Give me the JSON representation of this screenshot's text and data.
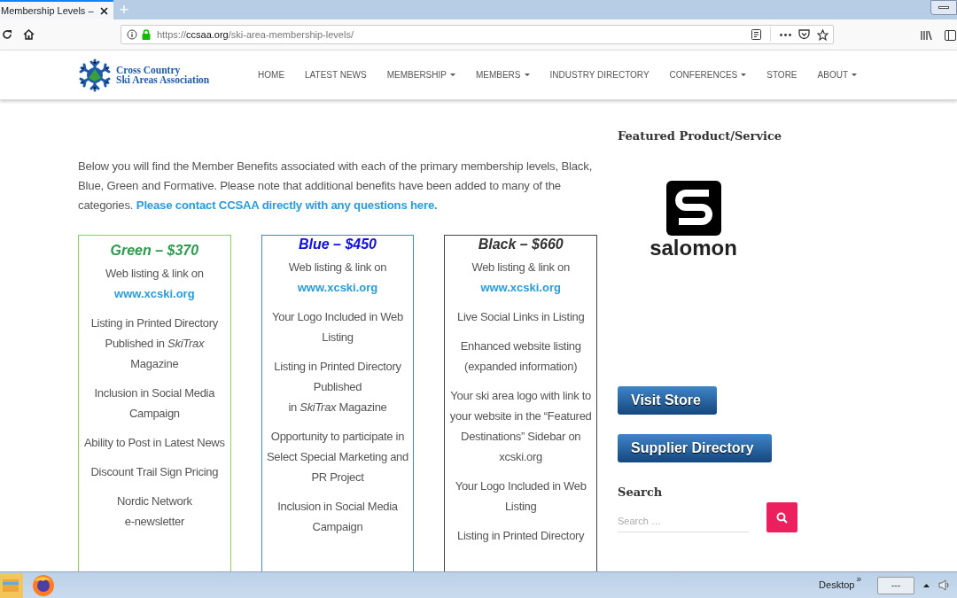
{
  "browser": {
    "tab_title": "Membership Levels –",
    "new_tab": "+",
    "url": {
      "scheme": "https://",
      "domain": "ccsaa.org",
      "path": "/ski-area-membership-levels/"
    }
  },
  "site": {
    "logo": {
      "line_1": "Cross Country",
      "line_2": "Ski Areas Association"
    },
    "nav": [
      {
        "label": "HOME",
        "dropdown": false
      },
      {
        "label": "LATEST NEWS",
        "dropdown": false
      },
      {
        "label": "MEMBERSHIP",
        "dropdown": true
      },
      {
        "label": "MEMBERS",
        "dropdown": true
      },
      {
        "label": "INDUSTRY DIRECTORY",
        "dropdown": false
      },
      {
        "label": "CONFERENCES",
        "dropdown": true
      },
      {
        "label": "STORE",
        "dropdown": false
      },
      {
        "label": "ABOUT",
        "dropdown": true
      }
    ]
  },
  "intro": {
    "text": "Below you will find the Member Benefits associated with each of the primary membership levels, Black, Blue, Green and Formative.  Please note that additional benefits have been added to many of the categories. ",
    "link": "Please contact CCSAA directly with any questions here."
  },
  "levels": [
    {
      "title": "Green – $370",
      "kind": "green",
      "color": "#2e9a4e",
      "benefits": [
        {
          "text": "Web listing & link on",
          "link": "www.xcski.org"
        },
        {
          "text": "Listing in Printed Directory Published in *SkiTrax* Magazine"
        },
        {
          "text": "Inclusion in Social Media Campaign"
        },
        {
          "text": "Ability to Post in Latest News"
        },
        {
          "text": "Discount Trail Sign Pricing"
        },
        {
          "text": "Nordic Network\ne-newsletter"
        }
      ]
    },
    {
      "title": "Blue – $450",
      "kind": "blue",
      "color": "#1010e0",
      "benefits": [
        {
          "text": "Web listing & link on",
          "link": "www.xcski.org"
        },
        {
          "text": "Your Logo Included in Web Listing"
        },
        {
          "text": "Listing in Printed Directory Published\nin *SkiTrax* Magazine"
        },
        {
          "text": "Opportunity to participate in Select Special Marketing and PR Project"
        },
        {
          "text": "Inclusion in Social Media Campaign"
        }
      ]
    },
    {
      "title": "Black – $660",
      "kind": "black",
      "color": "#333333",
      "benefits": [
        {
          "text": "Web listing & link on",
          "link": "www.xcski.org"
        },
        {
          "text": "Live Social Links in Listing"
        },
        {
          "text": "Enhanced website listing (expanded information)"
        },
        {
          "text": "Your ski area logo with link to your website  in the “Featured Destinations” Sidebar on xcski.org"
        },
        {
          "text": "Your Logo Included in Web Listing"
        },
        {
          "text": "Listing in Printed Directory"
        }
      ]
    }
  ],
  "sidebar": {
    "featured_heading": "Featured Product/Service",
    "featured_logo_text": "salomon",
    "buttons": [
      "Visit Store",
      "Supplier Directory"
    ],
    "search_heading": "Search",
    "search_placeholder": "Search …"
  },
  "taskbar": {
    "desktop_label": "Desktop",
    "chevron": "»",
    "battery_text": "---"
  }
}
